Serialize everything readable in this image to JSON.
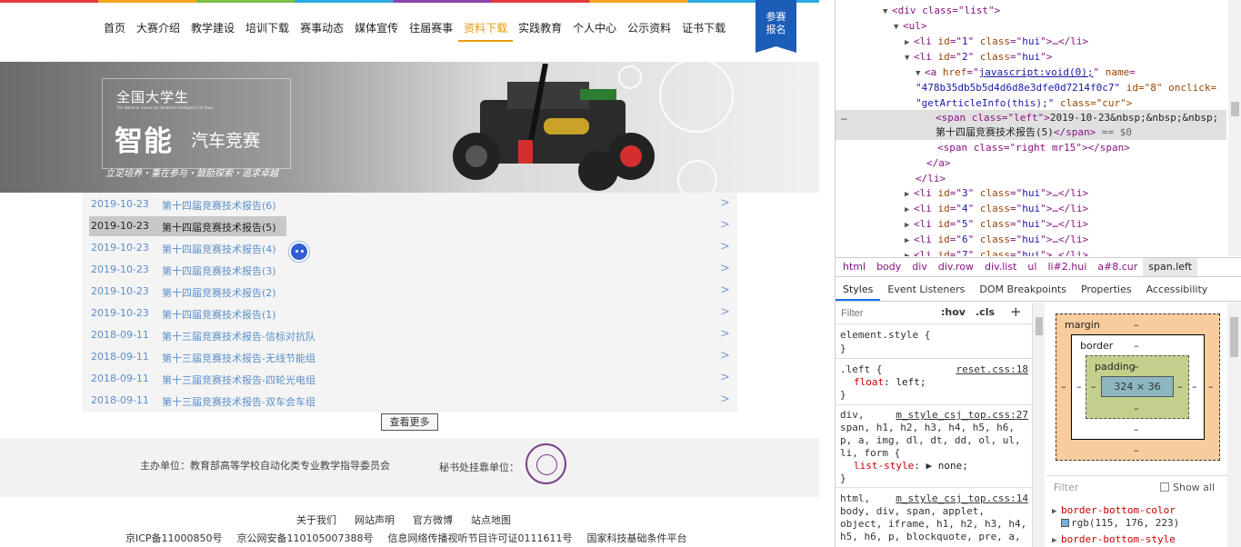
{
  "site": {
    "nav": [
      "首页",
      "大赛介绍",
      "教学建设",
      "培训下载",
      "赛事动态",
      "媒体宣传",
      "往届赛事",
      "资料下载",
      "实践教育",
      "个人中心",
      "公示资料",
      "证书下载"
    ],
    "nav_active": "资料下载",
    "signup_label_1": "参赛",
    "signup_label_2": "报名",
    "banner": {
      "line1": "全国大学生",
      "line2": "The National University Students Intelligent Car Race",
      "big": "智能",
      "small": "汽车竞赛",
      "slogan": "立足培养・重在参与・鼓励探索・追求卓越"
    },
    "articles": [
      {
        "date": "2019-10-23",
        "title": "第十四届竞赛技术报告(6)"
      },
      {
        "date": "2019-10-23",
        "title": "第十四届竞赛技术报告(5)"
      },
      {
        "date": "2019-10-23",
        "title": "第十四届竞赛技术报告(4)"
      },
      {
        "date": "2019-10-23",
        "title": "第十四届竞赛技术报告(3)"
      },
      {
        "date": "2019-10-23",
        "title": "第十四届竞赛技术报告(2)"
      },
      {
        "date": "2019-10-23",
        "title": "第十四届竞赛技术报告(1)"
      },
      {
        "date": "2018-09-11",
        "title": "第十三届竞赛技术报告-信标对抗队"
      },
      {
        "date": "2018-09-11",
        "title": "第十三届竞赛技术报告-无线节能组"
      },
      {
        "date": "2018-09-11",
        "title": "第十三届竞赛技术报告-四轮光电组"
      },
      {
        "date": "2018-09-11",
        "title": "第十三届竞赛技术报告-双车会车组"
      }
    ],
    "chevron": ">",
    "more_label": "查看更多",
    "footer": {
      "host": "主办单位：教育部高等学校自动化类专业教学指导委员会",
      "secretariat": "秘书处挂靠单位：",
      "links": [
        "关于我们",
        "网站声明",
        "官方微博",
        "站点地图"
      ],
      "icp": [
        "京ICP备11000850号",
        "京公网安备110105007388号",
        "信息网络传播视听节目许可证0111611号",
        "国家科技基础条件平台"
      ]
    }
  },
  "devtools": {
    "dom": {
      "l1_tag": "<div class=\"list\">",
      "l2_tag": "<ul>",
      "li1": [
        "<li ",
        "id",
        "=\"",
        "1",
        "\" ",
        "class",
        "=\"",
        "hui",
        "\">…</li>"
      ],
      "li2": [
        "<li ",
        "id",
        "=\"",
        "2",
        "\" ",
        "class",
        "=\"",
        "hui",
        "\">"
      ],
      "a_line1_pre": "<a ",
      "a_href_attr": "href",
      "a_href_val": "javascript:void(0);",
      "a_name_attr": "name",
      "a_line2": "\"478b35db5b5d4d6d8e3dfe0d7214f0c7\"",
      "a_id": "id=\"8\" onclick=",
      "a_line3": "\"getArticleInfo(this);\"",
      "a_class": "class=\"cur\">",
      "span_left_open": "<span class=\"left\">",
      "span_left_text": "2019-10-23&nbsp;&nbsp;&nbsp;",
      "span_left_text2": "第十四届竞赛技术报告(5)",
      "span_left_close": "</span>",
      "eq0": " == $0",
      "span_right": "<span class=\"right mr15\"></span>",
      "a_close": "</a>",
      "li_close": "</li>",
      "li_ids": [
        "3",
        "4",
        "5",
        "6",
        "7"
      ],
      "ellipsis": "…"
    },
    "crumbs": [
      "html",
      "body",
      "div",
      "div.row",
      "div.list",
      "ul",
      "li#2.hui",
      "a#8.cur",
      "span.left"
    ],
    "tabs": [
      "Styles",
      "Event Listeners",
      "DOM Breakpoints",
      "Properties",
      "Accessibility"
    ],
    "styles": {
      "filter_placeholder": "Filter",
      "hov": ":hov",
      "cls": ".cls",
      "plus": "+",
      "element_style": "element.style {",
      "close_brace": "}",
      "rule1_sel": ".left {",
      "rule1_src": "reset.css:18",
      "rule1_prop": "float",
      "rule1_val": "left;",
      "rule2_sel1": "div,",
      "rule2_src": "m_style_csj_top.css:27",
      "rule2_sel2": "span, h1, h2, h3, h4, h5, h6,",
      "rule2_sel3": "p, a, img, dl, dt, dd, ol, ul,",
      "rule2_sel4": "li, form {",
      "rule2_prop": "list-style",
      "rule2_val": "none;",
      "rule3_sel1": "html,",
      "rule3_src": "m_style_csj_top.css:14",
      "rule3_sel2": "body, div, span, applet,",
      "rule3_sel3": "object, iframe, h1, h2, h3, h4,",
      "rule3_sel4": "h5, h6, p, blockquote, pre, a,"
    },
    "boxmodel": {
      "margin": "margin",
      "border": "border",
      "padding": "padding",
      "dash": "–",
      "content": "324 × 36"
    },
    "computed": {
      "filter": "Filter",
      "show_all": "Show all",
      "p1": "border-bottom-color",
      "p1_val": "rgb(115, 176, 223)",
      "p2": "border-bottom-style"
    },
    "colors": {
      "accent": "#e89a0c",
      "link": "#5b8fc9",
      "signup": "#1c5db7",
      "swatch": "#73b0df"
    }
  }
}
